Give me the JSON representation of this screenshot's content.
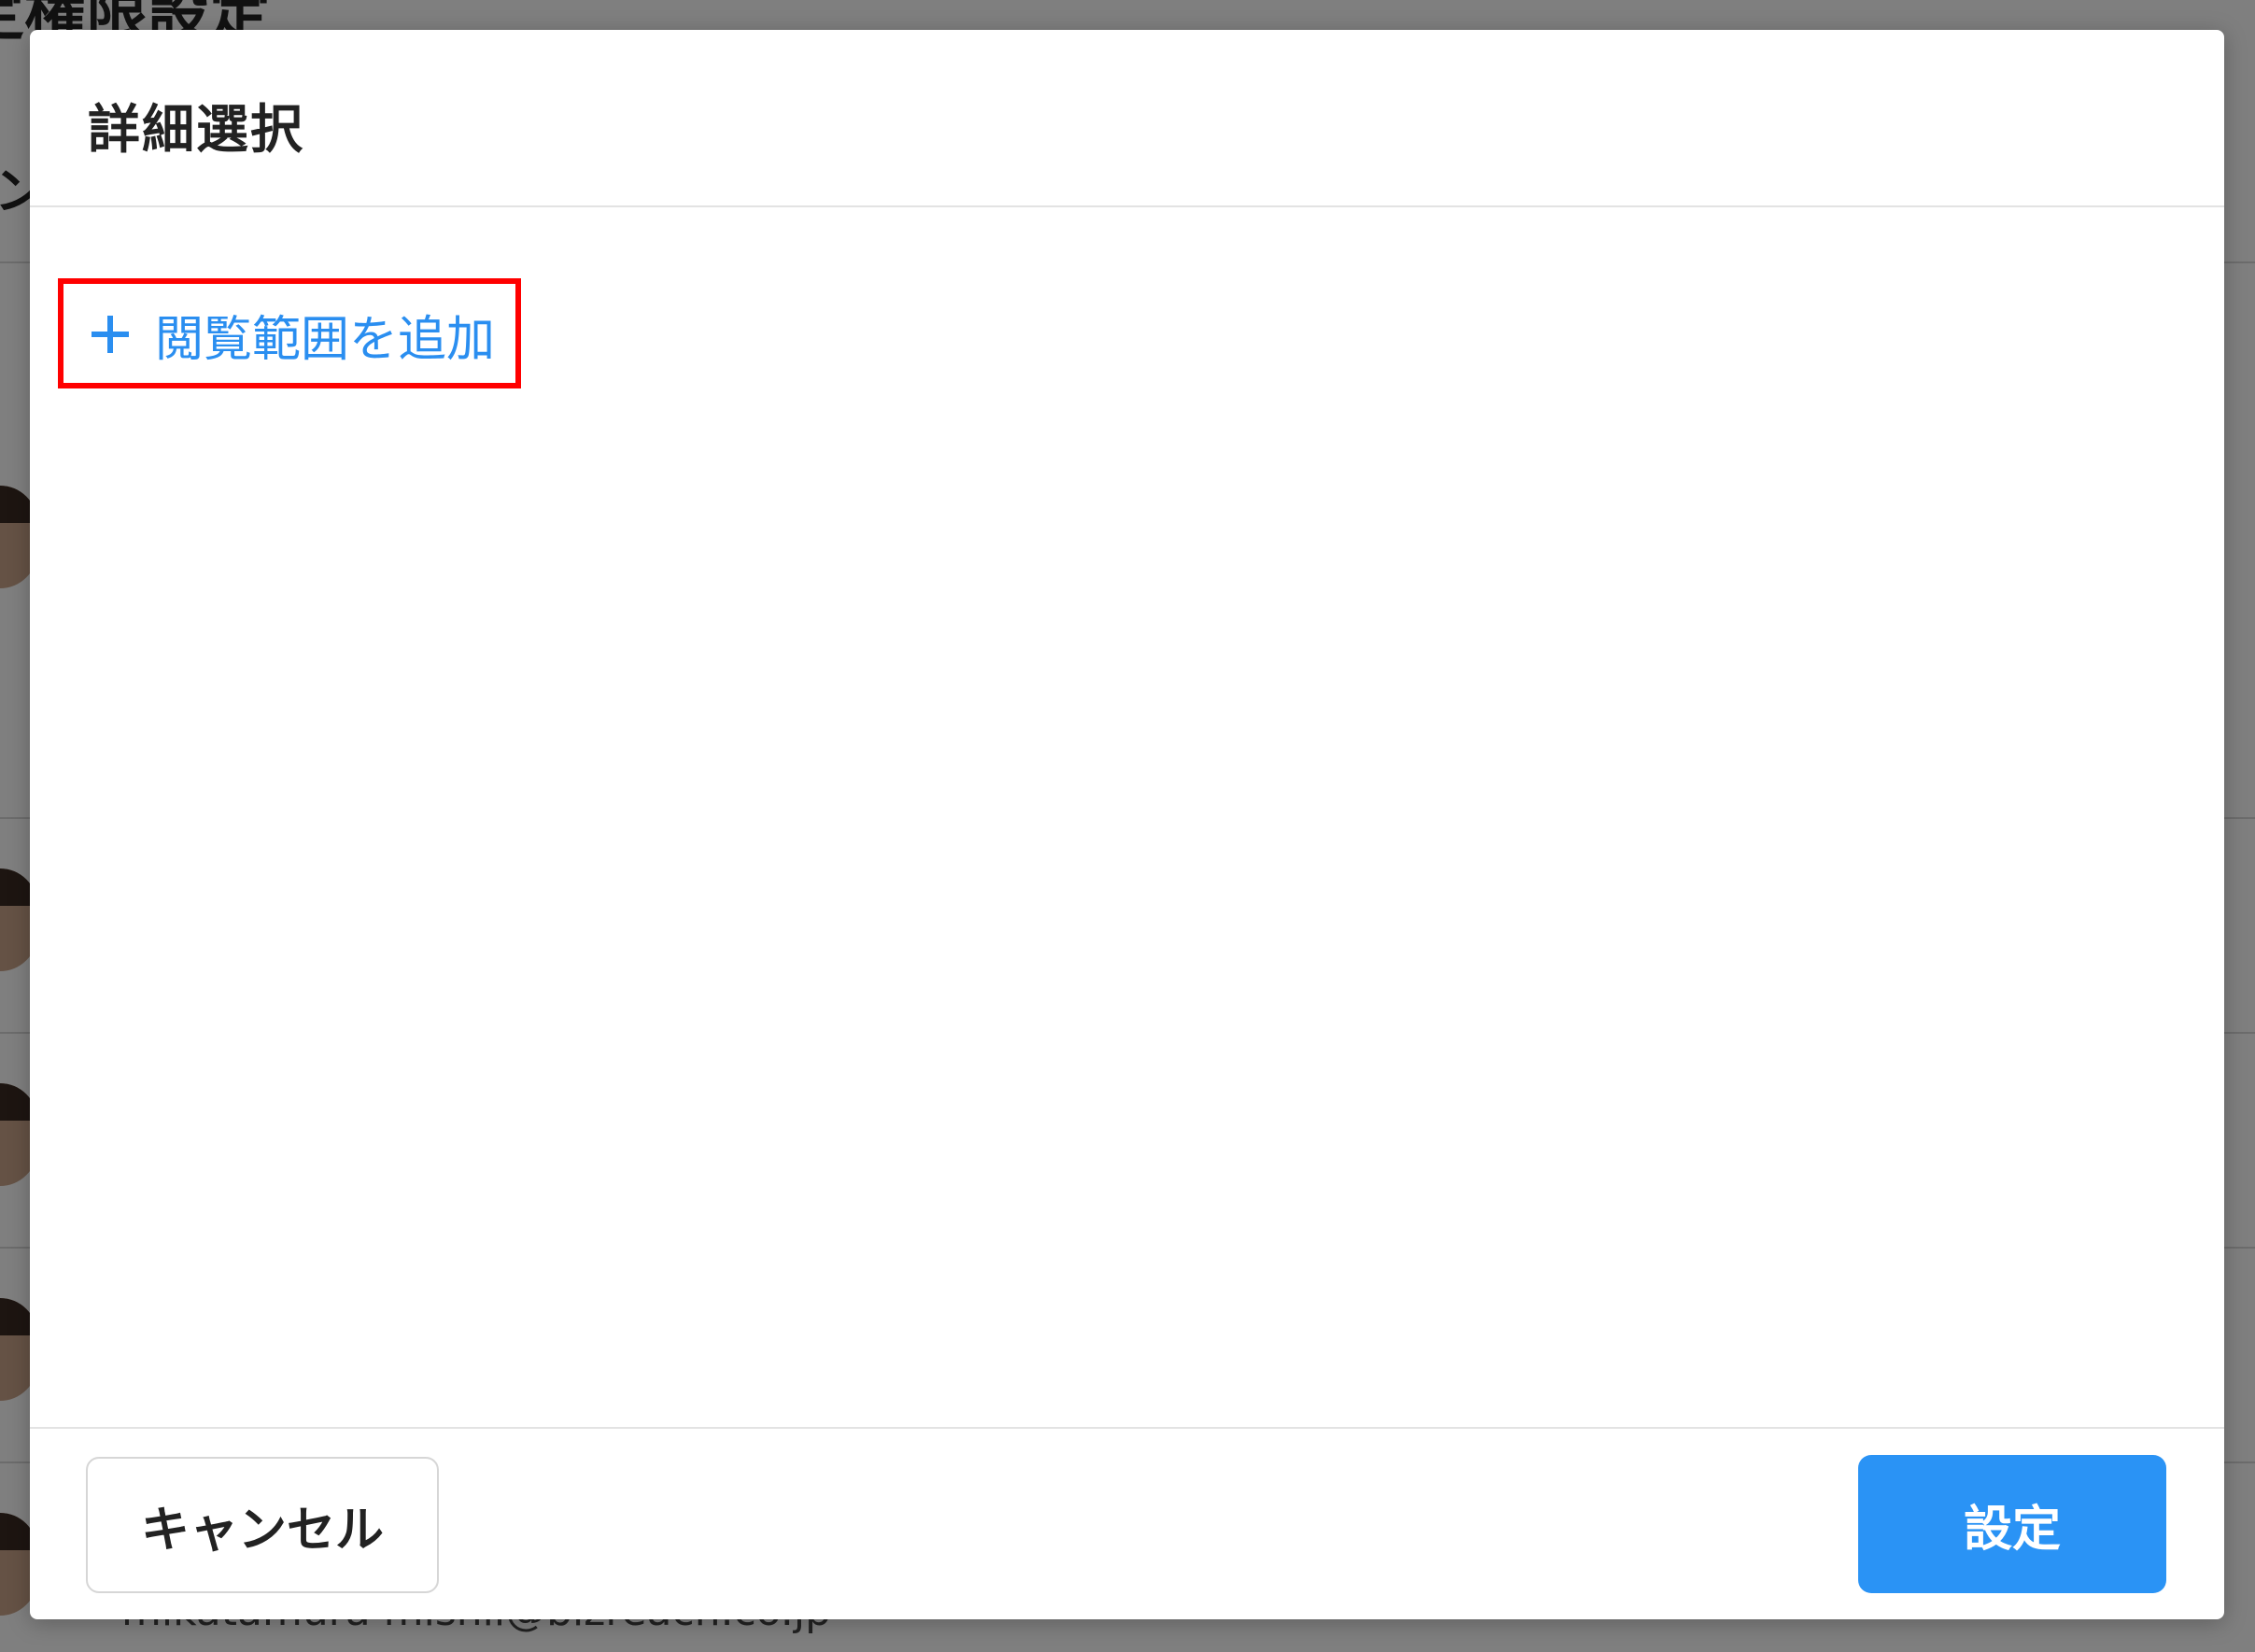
{
  "background": {
    "page_title": "定権限設定",
    "tab_fragment": "ン",
    "email_fragment": "mikatamura   misnii@bizreach.co.jp"
  },
  "modal": {
    "title": "詳細選択",
    "add_range_label": "閲覧範囲を追加",
    "cancel_label": "キャンセル",
    "submit_label": "設定"
  },
  "colors": {
    "accent": "#2a8ef0",
    "primary_button": "#2a93f5",
    "highlight": "#ff0000",
    "overlay": "rgba(0,0,0,0.5)"
  },
  "icons": {
    "add": "plus-icon"
  }
}
